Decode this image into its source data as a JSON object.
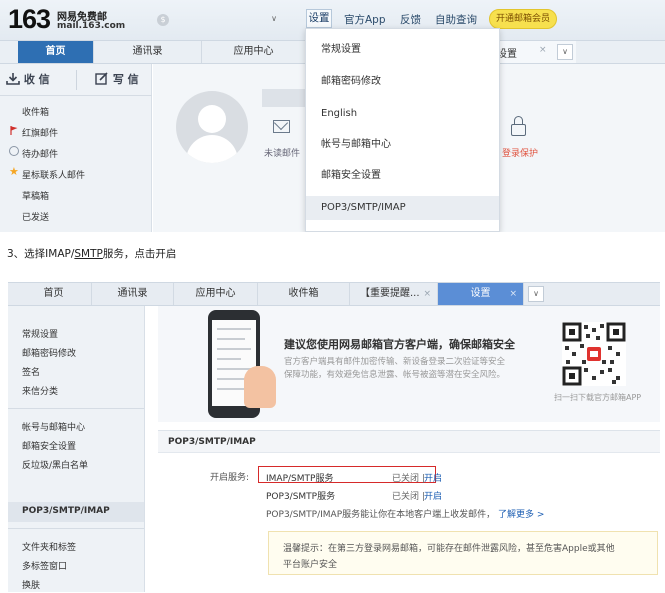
{
  "top": {
    "logo_num": "163",
    "logo_cn": "网易免费邮",
    "logo_url": "mail.163.com",
    "acct_icon": "$",
    "acct_arrow": "∨",
    "links": {
      "settings": "设置",
      "app": "官方App",
      "feedback": "反馈",
      "selfservice": "自助查询",
      "vip": "开通邮箱会员"
    }
  },
  "tabs1": {
    "home": "首页",
    "contacts": "通讯录",
    "apps": "应用中心",
    "settings_tail": "设置",
    "close": "×",
    "more": "∨"
  },
  "sidebar1": {
    "receive": "收 信",
    "write": "写 信",
    "items": [
      "收件箱",
      "红旗邮件",
      "待办邮件",
      "星标联系人邮件",
      "草稿箱",
      "已发送"
    ]
  },
  "main1": {
    "unread": "未读邮件",
    "protect": "登录保护"
  },
  "dropdown": {
    "items": [
      "常规设置",
      "邮箱密码修改",
      "English",
      "帐号与邮箱中心",
      "邮箱安全设置",
      "POP3/SMTP/IMAP"
    ]
  },
  "caption": {
    "prefix": "3、选择IMAP/",
    "smtp": "SMTP",
    "suffix": "服务，点击开启"
  },
  "tabs2": {
    "home": "首页",
    "contacts": "通讯录",
    "apps": "应用中心",
    "inbox": "收件箱",
    "alert": "【重要提醒...",
    "settings": "设置",
    "close": "×",
    "more": "∨"
  },
  "sidebar2": {
    "group1": [
      "常规设置",
      "邮箱密码修改",
      "签名",
      "来信分类"
    ],
    "group2": [
      "帐号与邮箱中心",
      "邮箱安全设置",
      "反垃圾/黑白名单",
      "POP3/SMTP/IMAP"
    ],
    "group3": [
      "文件夹和标签",
      "多标签窗口",
      "换肤"
    ]
  },
  "banner": {
    "title": "建议您使用网易邮箱官方客户端，确保邮箱安全",
    "sub_line1": "官方客户端具有邮件加密传输、新设备登录二次验证等安全",
    "sub_line2": "保障功能，有效避免信息泄露、帐号被盗等潜在安全风险。",
    "qr_label": "扫一扫下载官方邮箱APP"
  },
  "section": {
    "title": "POP3/SMTP/IMAP",
    "label": "开启服务:",
    "services": [
      {
        "name": "IMAP/SMTP服务",
        "status": "已关闭 |",
        "action": "开启"
      },
      {
        "name": "POP3/SMTP服务",
        "status": "已关闭 |",
        "action": "开启"
      }
    ],
    "note": "POP3/SMTP/IMAP服务能让你在本地客户端上收发邮件，",
    "more": "了解更多 >",
    "tip_line1": "温馨提示：在第三方登录网易邮箱，可能存在邮件泄露风险，甚至危害Apple或其他",
    "tip_line2": "平台账户安全"
  },
  "colors": {
    "accent_blue": "#2e6fb3",
    "highlight_red": "#d62a2a",
    "vip_yellow": "#f7e04e",
    "link_blue": "#1e5fb3"
  }
}
